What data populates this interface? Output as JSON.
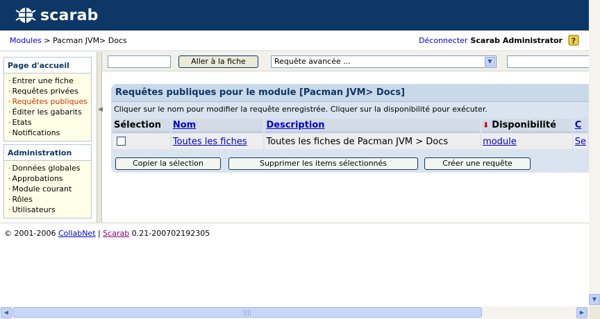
{
  "app": {
    "logo_text": "scarab"
  },
  "breadcrumb": {
    "modules_link": "Modules",
    "path_rest": " > Pacman JVM> Docs"
  },
  "user": {
    "logout": "Déconnecter",
    "name": "Scarab Administrator"
  },
  "sidebar": {
    "home_title": "Page d'accueil",
    "home_items": [
      {
        "label": "Entrer une fiche"
      },
      {
        "label": "Requêtes privées"
      },
      {
        "label": "Requêtes publiques",
        "active": true
      },
      {
        "label": "Éditer les gabarits"
      },
      {
        "label": "Etats"
      },
      {
        "label": "Notifications"
      }
    ],
    "admin_title": "Administration",
    "admin_items": [
      {
        "label": "Données globales"
      },
      {
        "label": "Approbations"
      },
      {
        "label": "Module courant"
      },
      {
        "label": "Rôles"
      },
      {
        "label": "Utilisateurs"
      }
    ]
  },
  "toolbar": {
    "issue_id_value": "",
    "goto_button": "Aller à la fiche",
    "query_select_value": "Requête avancée ...",
    "quick_search_value": ""
  },
  "panel": {
    "title": "Requêtes publiques pour le module [Pacman JVM> Docs]",
    "info": "Cliquer sur le nom pour modifier la requête enregistrée. Cliquer sur la disponibilité pour exécuter.",
    "columns": {
      "selection": "Sélection",
      "name": "Nom",
      "description": "Description",
      "availability": "Disponibilité",
      "extra": "C"
    },
    "rows": [
      {
        "name": "Toutes les fiches",
        "description": "Toutes les fiches de Pacman JVM > Docs",
        "availability": "module",
        "extra": "Se"
      }
    ],
    "buttons": {
      "copy": "Copier la sélection",
      "delete": "Supprimer les items sélectionnés",
      "create": "Créer une requête"
    }
  },
  "footer": {
    "copyright": "© 2001-2006 ",
    "collabnet": "CollabNet",
    "sep": " | ",
    "scarab": "Scarab",
    "version": " 0.21-200702192305"
  },
  "colors": {
    "header_bg": "#0d3766",
    "panel_head": "#c9d9ea",
    "active_link": "#cc3300"
  }
}
